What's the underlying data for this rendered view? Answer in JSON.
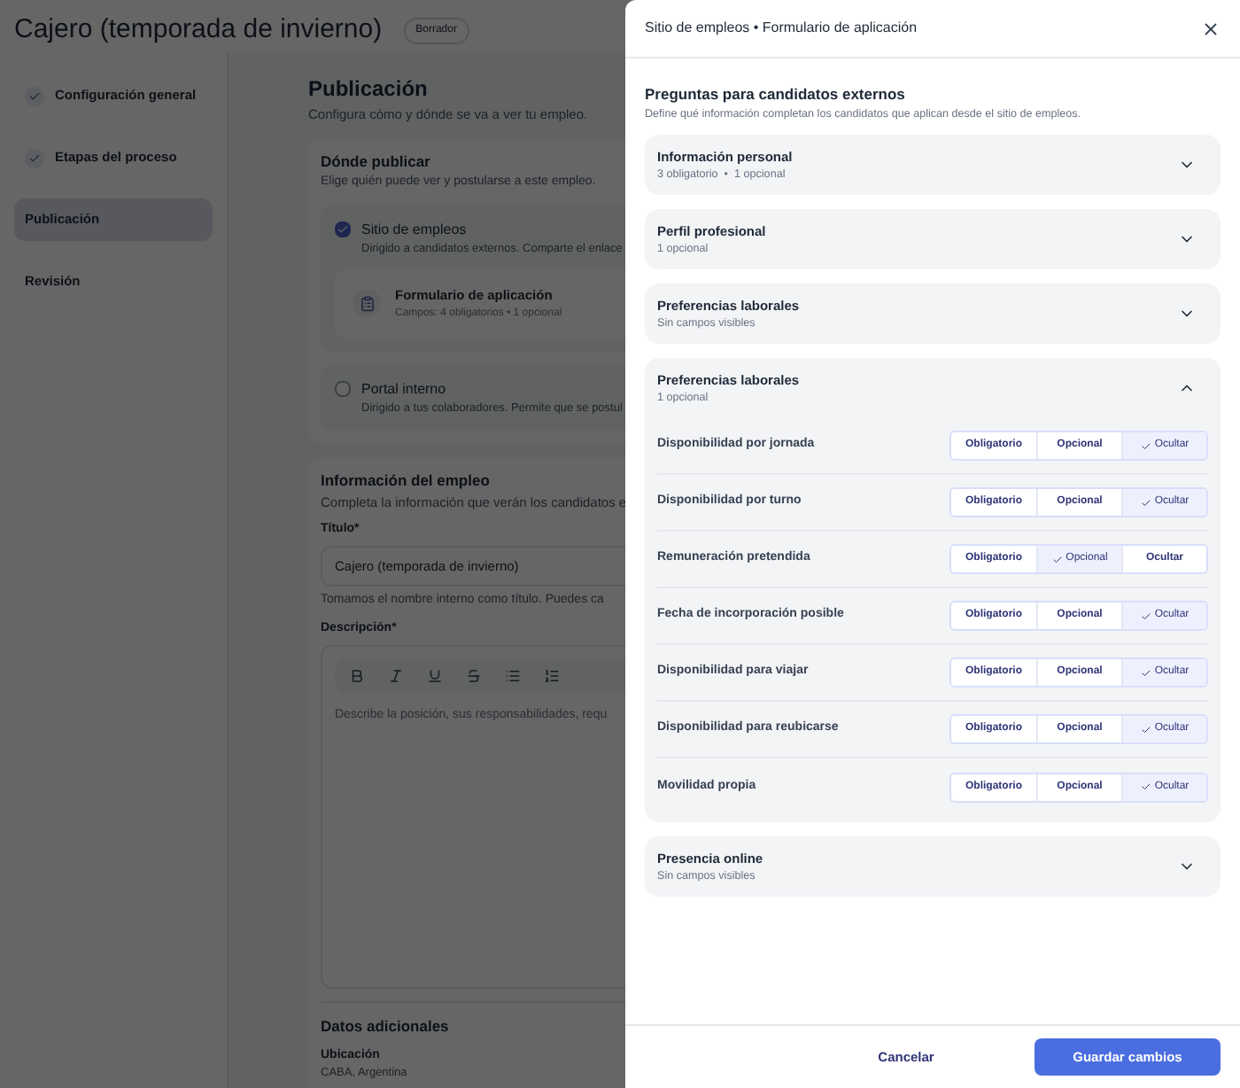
{
  "page": {
    "title": "Cajero (temporada de invierno)",
    "status_badge": "Borrador",
    "sidebar": {
      "items": [
        {
          "label": "Configuración general",
          "done": true,
          "selected": false
        },
        {
          "label": "Etapas del proceso",
          "done": true,
          "selected": false
        },
        {
          "label": "Publicación",
          "done": false,
          "selected": true
        },
        {
          "label": "Revisión",
          "done": false,
          "selected": false
        }
      ]
    },
    "publication": {
      "title": "Publicación",
      "subtitle": "Configura cómo y dónde se va a ver tu empleo."
    },
    "where": {
      "title": "Dónde publicar",
      "subtitle": "Elige quién puede ver y postularse a este empleo.",
      "channels": [
        {
          "label": "Sitio de empleos",
          "description": "Dirigido a candidatos externos. Comparte el enlace",
          "checked": true,
          "form": {
            "title": "Formulario de aplicación",
            "fields": "Campos: 4 obligatorios • 1 opcional"
          }
        },
        {
          "label": "Portal interno",
          "description": "Dirigido a tus colaboradores. Permite que se postul",
          "checked": false
        }
      ]
    },
    "job_info": {
      "title": "Información del empleo",
      "subtitle": "Completa la información que verán los candidatos e",
      "title_field": {
        "label": "Título*",
        "value": "Cajero (temporada de invierno)",
        "hint": "Tomamos el nombre interno como título. Puedes ca"
      },
      "description": {
        "label": "Descripción*",
        "placeholder": "Describe la posición, sus responsabilidades, requ"
      }
    },
    "additional": {
      "title": "Datos adicionales",
      "location": {
        "label": "Ubicación",
        "value": "CABA, Argentina"
      }
    }
  },
  "drawer": {
    "title": "Sitio de empleos • Formulario de aplicación",
    "section_title": "Preguntas para candidatos externos",
    "section_subtitle": "Define qué información completan los candidatos que aplican desde el sitio de empleos.",
    "groups": [
      {
        "title": "Información personal",
        "summary": "3 obligatorio  •  1 opcional",
        "expanded": false
      },
      {
        "title": "Perfil profesional",
        "summary": "1 opcional",
        "expanded": false
      },
      {
        "title": "Preferencias laborales",
        "summary": "Sin campos visibles",
        "expanded": false
      },
      {
        "title": "Preferencias laborales",
        "summary": "1 opcional",
        "expanded": true,
        "questions": [
          {
            "label": "Disponibilidad por jornada",
            "options": [
              {
                "label": "Obligatorio",
                "selected": false
              },
              {
                "label": "Opcional",
                "selected": false
              },
              {
                "label": "Ocultar",
                "selected": true
              }
            ]
          },
          {
            "label": "Disponibilidad por turno",
            "options": [
              {
                "label": "Obligatorio",
                "selected": false
              },
              {
                "label": "Opcional",
                "selected": false
              },
              {
                "label": "Ocultar",
                "selected": true
              }
            ]
          },
          {
            "label": "Remuneración pretendida",
            "options": [
              {
                "label": "Obligatorio",
                "selected": false
              },
              {
                "label": "Opcional",
                "selected": true
              },
              {
                "label": "Ocultar",
                "selected": false
              }
            ]
          },
          {
            "label": "Fecha de incorporación posible",
            "options": [
              {
                "label": "Obligatorio",
                "selected": false
              },
              {
                "label": "Opcional",
                "selected": false
              },
              {
                "label": "Ocultar",
                "selected": true
              }
            ]
          },
          {
            "label": "Disponibilidad para viajar",
            "options": [
              {
                "label": "Obligatorio",
                "selected": false
              },
              {
                "label": "Opcional",
                "selected": false
              },
              {
                "label": "Ocultar",
                "selected": true
              }
            ]
          },
          {
            "label": "Disponibilidad para reubicarse",
            "options": [
              {
                "label": "Obligatorio",
                "selected": false
              },
              {
                "label": "Opcional",
                "selected": false
              },
              {
                "label": "Ocultar",
                "selected": true
              }
            ]
          },
          {
            "label": "Movilidad propia",
            "options": [
              {
                "label": "Obligatorio",
                "selected": false
              },
              {
                "label": "Opcional",
                "selected": false
              },
              {
                "label": "Ocultar",
                "selected": true
              }
            ]
          }
        ]
      },
      {
        "title": "Presencia online",
        "summary": "Sin campos visibles",
        "expanded": false
      }
    ],
    "buttons": [
      {
        "label": "Cancelar",
        "kind": "secondary"
      },
      {
        "label": "Guardar cambios",
        "kind": "primary"
      }
    ]
  }
}
